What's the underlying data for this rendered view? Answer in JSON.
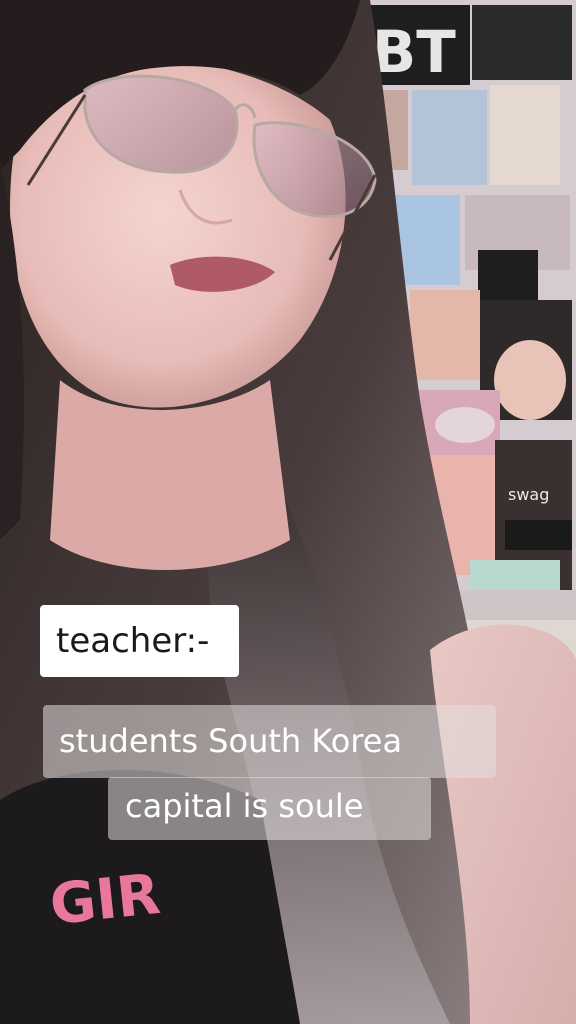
{
  "captions": {
    "teacher": "teacher:-",
    "line1": "students South Korea",
    "line2": "capital is soule"
  },
  "poster": {
    "bts_text": "BT",
    "sticker_text": "swag",
    "shirt_text": "GIR"
  },
  "colors": {
    "caption_box": "#ffffff",
    "caption_translucent": "#e4dede",
    "caption_text_dark": "#1a1a1a",
    "caption_text_light": "#ffffff"
  }
}
